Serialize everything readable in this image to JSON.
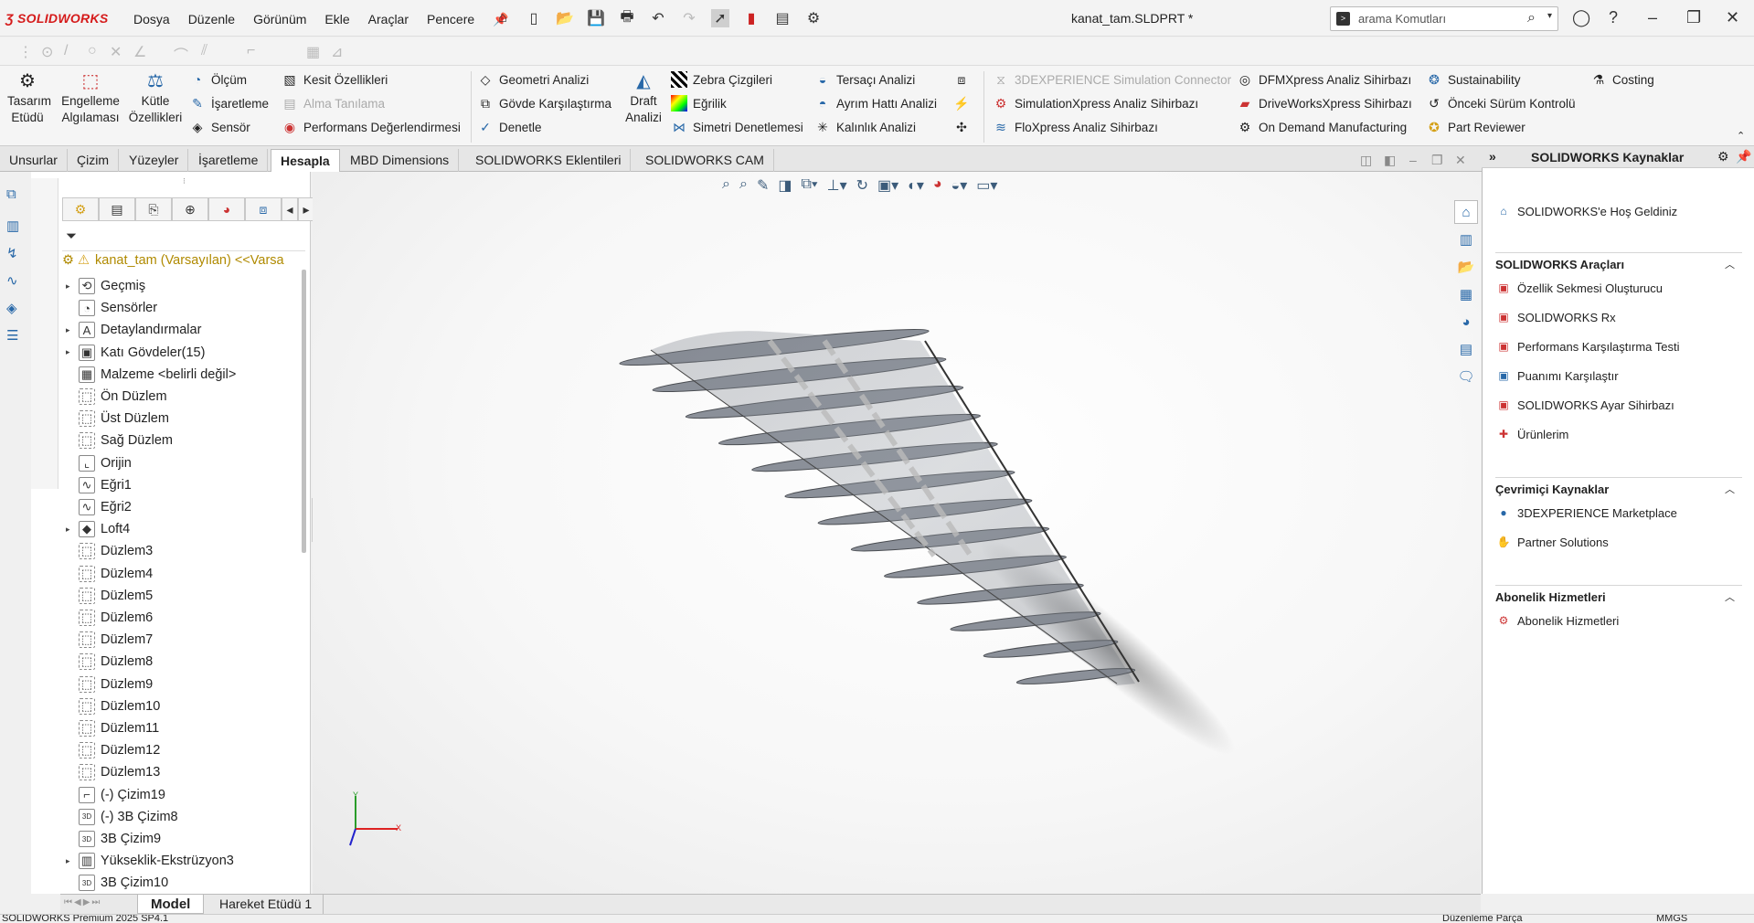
{
  "app": {
    "logo": "SOLIDWORKS",
    "document_title": "kanat_tam.SLDPRT *"
  },
  "menu": [
    "Dosya",
    "Düzenle",
    "Görünüm",
    "Ekle",
    "Araçlar",
    "Pencere"
  ],
  "search": {
    "placeholder": "arama Komutları"
  },
  "ribbon": {
    "tasarim": "Tasarım",
    "etudu": "Etüdü",
    "engelleme1": "Engelleme",
    "engelleme2": "Algılaması",
    "kutle1": "Kütle",
    "kutle2": "Özellikleri",
    "olcum": "Ölçüm",
    "isaretleme": "İşaretleme",
    "sensor": "Sensör",
    "kesit": "Kesit Özellikleri",
    "alma": "Alma Tanılama",
    "performans": "Performans Değerlendirmesi",
    "geometri": "Geometri Analizi",
    "govde": "Gövde Karşılaştırma",
    "denetle": "Denetle",
    "draft1": "Draft",
    "draft2": "Analizi",
    "zebra": "Zebra Çizgileri",
    "egrilik": "Eğrilik",
    "simetri": "Simetri Denetlemesi",
    "tersaci": "Tersaçı Analizi",
    "ayrim": "Ayrım Hattı Analizi",
    "kalinlik": "Kalınlık Analizi",
    "sim3dx": "3DEXPERIENCE Simulation Connector",
    "simx": "SimulationXpress Analiz Sihirbazı",
    "flox": "FloXpress Analiz Sihirbazı",
    "dfmx": "DFMXpress Analiz Sihirbazı",
    "dwx": "DriveWorksXpress Sihirbazı",
    "odm": "On Demand Manufacturing",
    "sustain": "Sustainability",
    "onceki": "Önceki Sürüm Kontrolü",
    "partrev": "Part Reviewer",
    "costing": "Costing"
  },
  "tabs": [
    "Unsurlar",
    "Çizim",
    "Yüzeyler",
    "İşaretleme",
    "Hesapla",
    "MBD Dimensions",
    "SOLIDWORKS Eklentileri",
    "SOLIDWORKS CAM"
  ],
  "active_tab": "Hesapla",
  "tree": {
    "root": "kanat_tam (Varsayılan) <<Varsa",
    "items": [
      "Geçmiş",
      "Sensörler",
      "Detaylandırmalar",
      "Katı Gövdeler(15)",
      "Malzeme <belirli değil>",
      "Ön Düzlem",
      "Üst Düzlem",
      "Sağ Düzlem",
      "Orijin",
      "Eğri1",
      "Eğri2",
      "Loft4",
      "Düzlem3",
      "Düzlem4",
      "Düzlem5",
      "Düzlem6",
      "Düzlem7",
      "Düzlem8",
      "Düzlem9",
      "Düzlem10",
      "Düzlem11",
      "Düzlem12",
      "Düzlem13",
      "(-) Çizim19",
      "(-) 3B Çizim8",
      "3B Çizim9",
      "Yükseklik-Ekstrüzyon3",
      "3B Çizim10"
    ]
  },
  "taskpane": {
    "title": "SOLIDWORKS Kaynaklar",
    "welcome": "SOLIDWORKS'e Hoş Geldiniz",
    "tools_title": "SOLIDWORKS Araçları",
    "tools": [
      "Özellik Sekmesi Oluşturucu",
      "SOLIDWORKS Rx",
      "Performans Karşılaştırma Testi",
      "Puanımı Karşılaştır",
      "SOLIDWORKS Ayar Sihirbazı",
      "Ürünlerim"
    ],
    "online_title": "Çevrimiçi Kaynaklar",
    "online": [
      "3DEXPERIENCE Marketplace",
      "Partner Solutions"
    ],
    "sub_title": "Abonelik Hizmetleri",
    "sub": [
      "Abonelik Hizmetleri"
    ]
  },
  "bottom_tabs": [
    "Model",
    "Hareket Etüdü 1"
  ],
  "status": {
    "left": "SOLIDWORKS Premium 2025 SP4.1",
    "mode": "Düzenleme Parça",
    "units": "MMGS"
  },
  "axes": {
    "x": "X",
    "y": "Y"
  },
  "colors": {
    "brand": "#d51a1a",
    "accent": "#2868a8",
    "wing": "#8a8f98"
  }
}
